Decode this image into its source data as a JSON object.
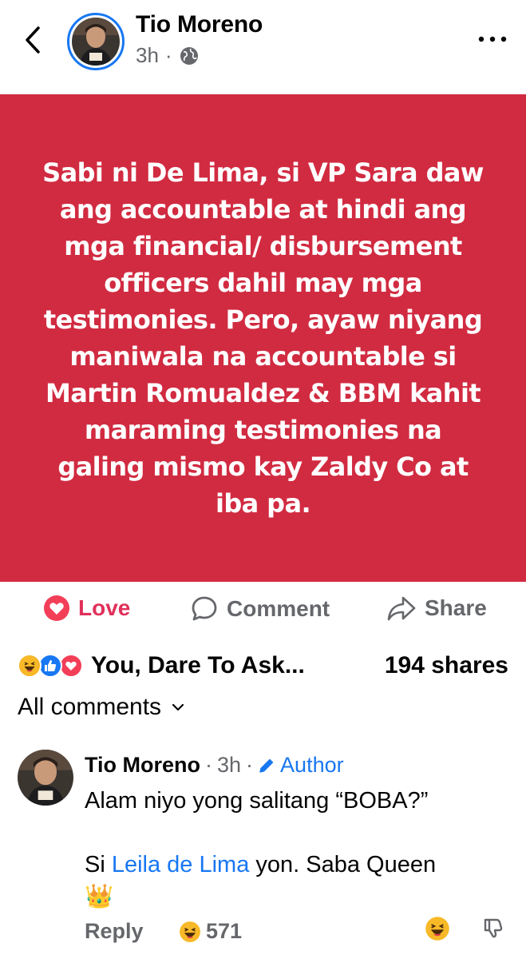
{
  "header": {
    "author_name": "Tio Moreno",
    "time": "3h",
    "separator": "·",
    "audience_icon": "globe-icon"
  },
  "post": {
    "text": "Sabi ni De Lima, si VP Sara daw ang accountable at hindi ang mga financial/ disbursement officers dahil may mga testimonies. Pero, ayaw niyang maniwala na accountable si Martin Romualdez & BBM kahit maraming testimonies na galing mismo kay Zaldy Co at iba pa.",
    "background_color": "#d12b41"
  },
  "actions": {
    "love_label": "Love",
    "comment_label": "Comment",
    "share_label": "Share"
  },
  "summary": {
    "names": "You, Dare To Ask...",
    "shares": "194 shares",
    "reactions": [
      "haha",
      "like",
      "love"
    ]
  },
  "comments_filter": {
    "label": "All comments"
  },
  "comment": {
    "author": "Tio Moreno",
    "separator": "·",
    "time": "3h",
    "separator2": "·",
    "badge": "Author",
    "line1": "Alam niyo yong salitang “BOBA?”",
    "line2_prefix": "Si ",
    "mention": "Leila de Lima",
    "line2_suffix": " yon. Saba Queen",
    "emoji": "👑",
    "reply_label": "Reply",
    "reaction_count": "571"
  },
  "colors": {
    "accent_blue": "#1877f2",
    "love_red": "#e0315a",
    "muted": "#65676b"
  }
}
